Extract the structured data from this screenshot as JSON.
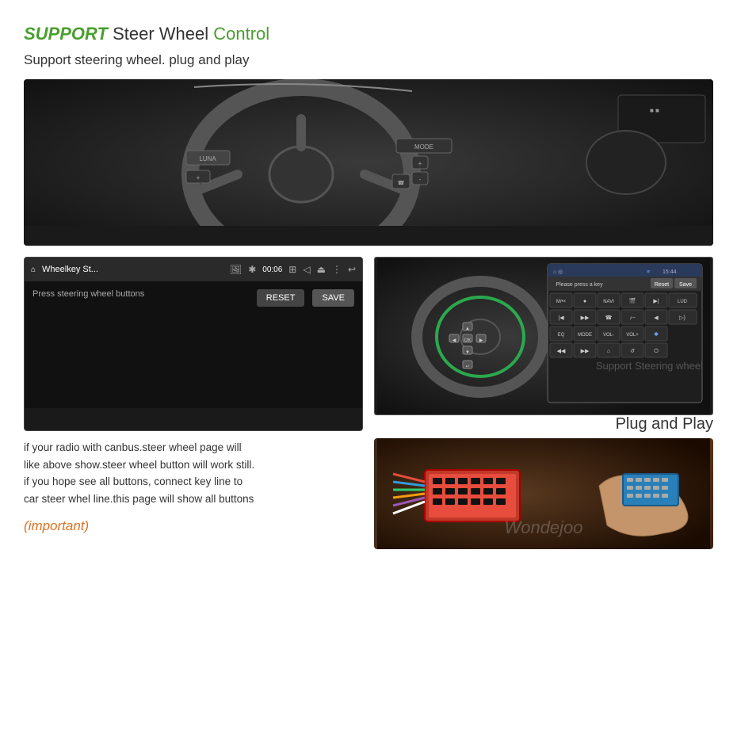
{
  "title": {
    "support_bold": "SUPPORT",
    "steer_wheel": " Steer Wheel ",
    "control": "Control"
  },
  "subtitle": "Support steering wheel. plug and play",
  "android_ui": {
    "app_name": "Wheelkey St...",
    "time": "00:06",
    "press_text": "Press steering wheel buttons",
    "reset_btn": "RESET",
    "save_btn": "SAVE"
  },
  "stereo_ui": {
    "time": "15:44",
    "please_press": "Please press a key",
    "reset": "Reset",
    "save": "Save",
    "buttons": [
      "M/•×",
      "●",
      "NAVI",
      "🎬",
      "▶|",
      "LUD",
      "◀◀",
      "▶▶",
      "📞",
      "♪",
      "◀◀",
      "EQ",
      "MODE",
      "VOL-",
      "VOL+",
      "🔵",
      "◀◀",
      "▶▶",
      "🏠",
      "↺",
      "⏻"
    ]
  },
  "support_label": "Support Steering wheel",
  "plug_and_play": "Plug and Play",
  "description": {
    "line1": "if your radio with canbus.steer wheel page will",
    "line2": "like above show.steer wheel button will work still.",
    "line3": "if you hope see all buttons, connect key line to",
    "line4": "car steer whel line.this page will show all buttons"
  },
  "important": "(important)",
  "watermark": "Wondejoo"
}
